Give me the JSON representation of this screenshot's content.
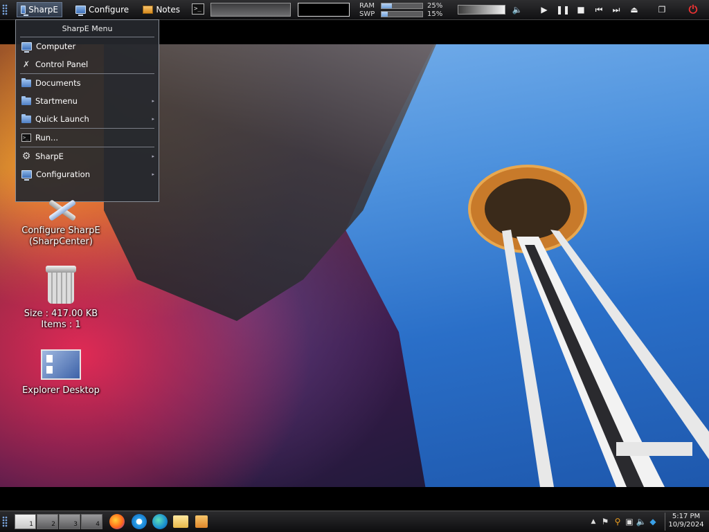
{
  "topbar": {
    "sharpe_label": "SharpE",
    "configure_label": "Configure",
    "notes_label": "Notes",
    "terminal_glyph": ">_",
    "ram_label": "RAM",
    "swp_label": "SWP",
    "ram_percent": 25,
    "swp_percent": 15,
    "ram_value": "25%",
    "swp_value": "15%"
  },
  "menu": {
    "title": "SharpE Menu",
    "items": [
      {
        "label": "Computer"
      },
      {
        "label": "Control Panel"
      },
      {
        "label": "Documents"
      },
      {
        "label": "Startmenu",
        "submenu": true
      },
      {
        "label": "Quick Launch",
        "submenu": true
      },
      {
        "label": "Run..."
      },
      {
        "label": "SharpE",
        "submenu": true
      },
      {
        "label": "Configuration",
        "submenu": true
      }
    ]
  },
  "desktop": {
    "config_line1": "Configure SharpE",
    "config_line2": "(SharpCenter)",
    "trash_size": "Size : 417.00 KB",
    "trash_items": "Items : 1",
    "explorer_label": "Explorer Desktop"
  },
  "taskbar": {
    "workspaces": [
      "1",
      "2",
      "3",
      "4"
    ],
    "active_workspace": 1,
    "time": "5:17 PM",
    "date": "10/9/2024"
  },
  "icons": {
    "power": "power-icon",
    "play": "play-icon",
    "pause": "pause-icon",
    "stop": "stop-icon",
    "prev": "previous-icon",
    "next": "next-icon"
  }
}
